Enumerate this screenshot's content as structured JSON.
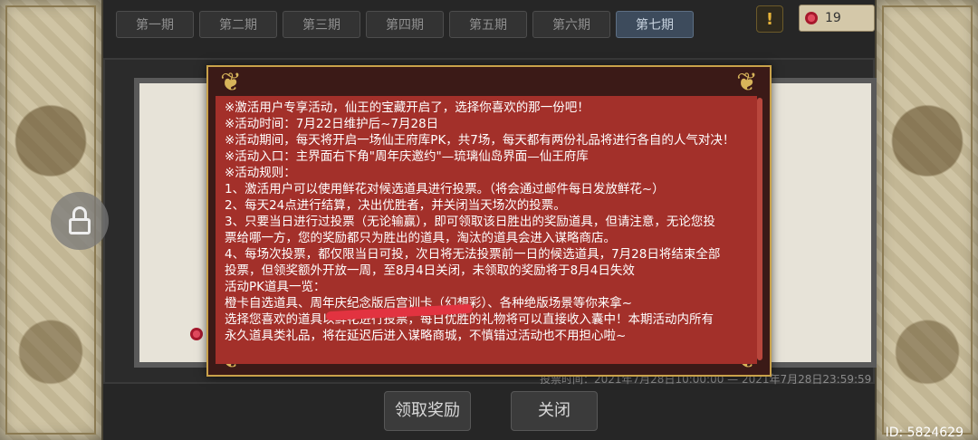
{
  "tabs": [
    {
      "label": "第一期",
      "active": false
    },
    {
      "label": "第二期",
      "active": false
    },
    {
      "label": "第三期",
      "active": false
    },
    {
      "label": "第四期",
      "active": false
    },
    {
      "label": "第五期",
      "active": false
    },
    {
      "label": "第六期",
      "active": false
    },
    {
      "label": "第七期",
      "active": true
    }
  ],
  "header": {
    "warning_icon": "!",
    "flower_count": "19"
  },
  "modal": {
    "lines": [
      "※激活用户专享活动，仙王的宝藏开启了，选择你喜欢的那一份吧！",
      "※活动时间：7月22日维护后~7月28日",
      "※活动期间，每天将开启一场仙王府库PK，共7场，每天都有两份礼品将进行各自的人气对决！",
      "※活动入口：主界面右下角\"周年庆邀约\"—琉璃仙岛界面—仙王府库",
      "※活动规则：",
      "1、激活用户可以使用鲜花对候选道具进行投票。（将会通过邮件每日发放鲜花~）",
      "2、每天24点进行结算，决出优胜者，并关闭当天场次的投票。",
      "3、只要当日进行过投票（无论输赢），即可领取该日胜出的奖励道具，但请注意，无论您投",
      "票给哪一方，您的奖励都只为胜出的道具，淘汰的道具会进入谋略商店。",
      "4、每场次投票，都仅限当日可投，次日将无法投票前一日的候选道具，7月28日将结束全部",
      "投票，但领奖额外开放一周，至8月4日关闭，未领取的奖励将于8月4日失效",
      "活动PK道具一览：",
      "橙卡自选道具、周年庆纪念版后宫训卡（幻想彩）、各种绝版场景等你来拿~",
      "选择您喜欢的道具以鲜花进行投票，每日优胜的礼物将可以直接收入囊中！本期活动内所有",
      "永久道具类礼品，将在延迟后进入谋略商城，不慎错过活动也不用担心啦~"
    ]
  },
  "vote_time_text": "投票时间：2021年7月28日10:00:00 — 2021年7月28日23:59:59",
  "buttons": {
    "claim": "领取奖励",
    "close": "关闭"
  },
  "id_label": "ID: 5824629"
}
